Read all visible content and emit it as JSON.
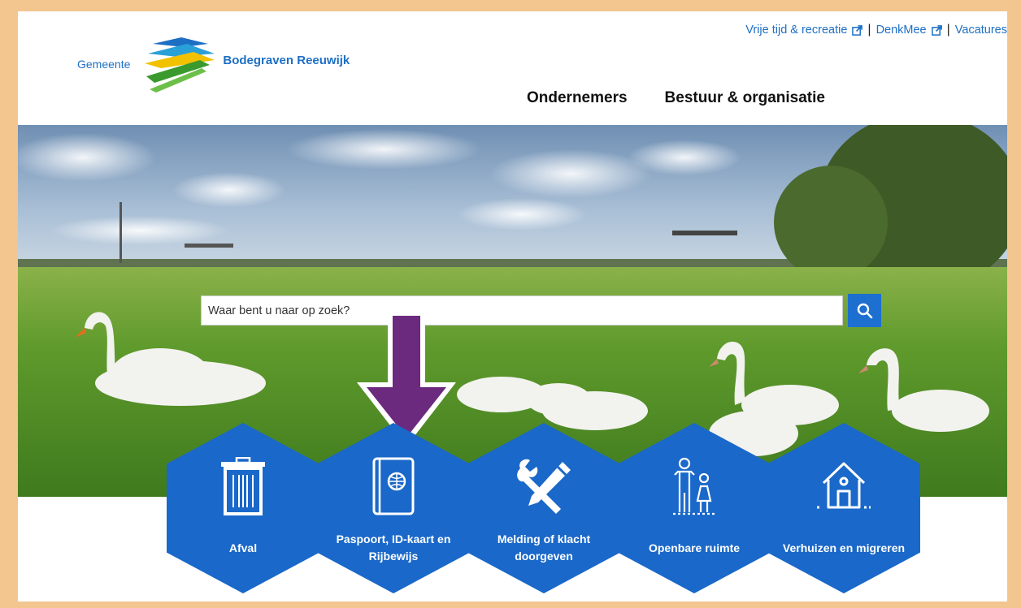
{
  "header": {
    "logo_prefix": "Gemeente",
    "logo_name": "Bodegraven Reeuwijk",
    "top_links": [
      {
        "label": "Vrije tijd & recreatie",
        "external": true
      },
      {
        "label": "DenkMee",
        "external": true
      },
      {
        "label": "Vacatures",
        "external": false
      }
    ],
    "separator": "|",
    "nav": [
      "Ondernemers",
      "Bestuur & organisatie"
    ]
  },
  "search": {
    "placeholder": "Waar bent u naar op zoek?",
    "button_icon": "search-icon"
  },
  "tiles": [
    {
      "label": "Afval",
      "icon": "trash-bin-icon"
    },
    {
      "label": "Paspoort, ID-kaart en Rijbewijs",
      "icon": "passport-icon"
    },
    {
      "label": "Melding of klacht doorgeven",
      "icon": "tools-icon"
    },
    {
      "label": "Openbare ruimte",
      "icon": "people-icon"
    },
    {
      "label": "Verhuizen en migreren",
      "icon": "house-icon"
    }
  ],
  "colors": {
    "frame": "#f3c58f",
    "accent_blue": "#1a68c9",
    "link_blue": "#1d6fc4",
    "annotation_arrow": "#6b2a7e"
  }
}
